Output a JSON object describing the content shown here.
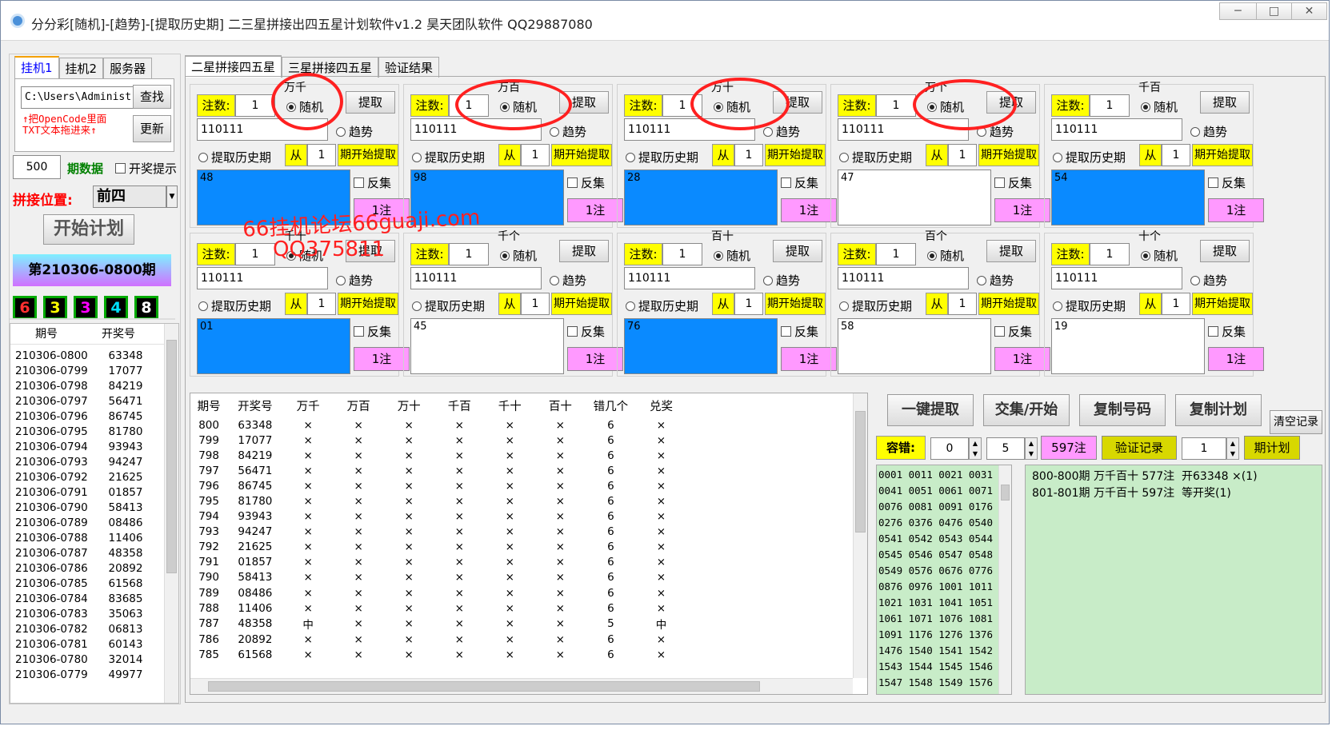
{
  "window": {
    "title": "分分彩[随机]-[趋势]-[提取历史期] 二三星拼接出四五星计划软件v1.2 昊天团队软件 QQ29887080",
    "buttons": {
      "minimize": "─",
      "maximize": "□",
      "close": "✕"
    }
  },
  "left": {
    "tabs": [
      "挂机1",
      "挂机2",
      "服务器"
    ],
    "path": "C:\\Users\\Administ",
    "lookup_btn": "查找",
    "update_btn": "更新",
    "hint_line1": "↑把OpenCode里面",
    "hint_line2": "TXT文本拖进来↑",
    "periods_value": "500",
    "periods_label": "期数据",
    "open_hint": "开奖提示",
    "join_label": "拼接位置:",
    "join_value": "前四",
    "start_btn": "开始计划",
    "current_issue": "第210306-0800期",
    "digits": [
      {
        "v": "6",
        "c": "#ff3030"
      },
      {
        "v": "3",
        "c": "#ffff00"
      },
      {
        "v": "3",
        "c": "#ff00ff"
      },
      {
        "v": "4",
        "c": "#00e0ff"
      },
      {
        "v": "8",
        "c": "#ffffff"
      }
    ],
    "history_headers": [
      "期号",
      "开奖号"
    ],
    "history": [
      [
        "210306-0800",
        "63348"
      ],
      [
        "210306-0799",
        "17077"
      ],
      [
        "210306-0798",
        "84219"
      ],
      [
        "210306-0797",
        "56471"
      ],
      [
        "210306-0796",
        "86745"
      ],
      [
        "210306-0795",
        "81780"
      ],
      [
        "210306-0794",
        "93943"
      ],
      [
        "210306-0793",
        "94247"
      ],
      [
        "210306-0792",
        "21625"
      ],
      [
        "210306-0791",
        "01857"
      ],
      [
        "210306-0790",
        "58413"
      ],
      [
        "210306-0789",
        "08486"
      ],
      [
        "210306-0788",
        "11406"
      ],
      [
        "210306-0787",
        "48358"
      ],
      [
        "210306-0786",
        "20892"
      ],
      [
        "210306-0785",
        "61568"
      ],
      [
        "210306-0784",
        "83685"
      ],
      [
        "210306-0783",
        "35063"
      ],
      [
        "210306-0782",
        "06813"
      ],
      [
        "210306-0781",
        "60143"
      ],
      [
        "210306-0780",
        "32014"
      ],
      [
        "210306-0779",
        "49977"
      ]
    ]
  },
  "main": {
    "tabs": [
      "二星拼接四五星",
      "三星拼接四五星",
      "验证结果"
    ],
    "labels": {
      "zhushu": "注数:",
      "extract": "提取",
      "random": "随机",
      "trend": "趋势",
      "history": "提取历史期",
      "from": "从",
      "period_start": "期开始提取",
      "reverse": "反集",
      "one_bet": "1注"
    },
    "panels": [
      {
        "title": "万千",
        "zhu": "1",
        "code": "110111",
        "from": "1",
        "result": "48",
        "blue": true
      },
      {
        "title": "万百",
        "zhu": "1",
        "code": "110111",
        "from": "1",
        "result": "98",
        "blue": true
      },
      {
        "title": "万十",
        "zhu": "1",
        "code": "110111",
        "from": "1",
        "result": "28",
        "blue": true
      },
      {
        "title": "万个",
        "zhu": "1",
        "code": "110111",
        "from": "1",
        "result": "47",
        "blue": false
      },
      {
        "title": "千百",
        "zhu": "1",
        "code": "110111",
        "from": "1",
        "result": "54",
        "blue": true
      },
      {
        "title": "千十",
        "zhu": "1",
        "code": "110111",
        "from": "1",
        "result": "01",
        "blue": true
      },
      {
        "title": "千个",
        "zhu": "1",
        "code": "110111",
        "from": "1",
        "result": "45",
        "blue": false
      },
      {
        "title": "百十",
        "zhu": "1",
        "code": "110111",
        "from": "1",
        "result": "76",
        "blue": true
      },
      {
        "title": "百个",
        "zhu": "1",
        "code": "110111",
        "from": "1",
        "result": "58",
        "blue": false
      },
      {
        "title": "十个",
        "zhu": "1",
        "code": "110111",
        "from": "1",
        "result": "19",
        "blue": false
      }
    ],
    "grid_headers": [
      "期号",
      "开奖号",
      "万千",
      "万百",
      "万十",
      "千百",
      "千十",
      "百十",
      "错几个",
      "兑奖"
    ],
    "grid_rows": [
      [
        "800",
        "63348",
        "×",
        "×",
        "×",
        "×",
        "×",
        "×",
        "6",
        "×"
      ],
      [
        "799",
        "17077",
        "×",
        "×",
        "×",
        "×",
        "×",
        "×",
        "6",
        "×"
      ],
      [
        "798",
        "84219",
        "×",
        "×",
        "×",
        "×",
        "×",
        "×",
        "6",
        "×"
      ],
      [
        "797",
        "56471",
        "×",
        "×",
        "×",
        "×",
        "×",
        "×",
        "6",
        "×"
      ],
      [
        "796",
        "86745",
        "×",
        "×",
        "×",
        "×",
        "×",
        "×",
        "6",
        "×"
      ],
      [
        "795",
        "81780",
        "×",
        "×",
        "×",
        "×",
        "×",
        "×",
        "6",
        "×"
      ],
      [
        "794",
        "93943",
        "×",
        "×",
        "×",
        "×",
        "×",
        "×",
        "6",
        "×"
      ],
      [
        "793",
        "94247",
        "×",
        "×",
        "×",
        "×",
        "×",
        "×",
        "6",
        "×"
      ],
      [
        "792",
        "21625",
        "×",
        "×",
        "×",
        "×",
        "×",
        "×",
        "6",
        "×"
      ],
      [
        "791",
        "01857",
        "×",
        "×",
        "×",
        "×",
        "×",
        "×",
        "6",
        "×"
      ],
      [
        "790",
        "58413",
        "×",
        "×",
        "×",
        "×",
        "×",
        "×",
        "6",
        "×"
      ],
      [
        "789",
        "08486",
        "×",
        "×",
        "×",
        "×",
        "×",
        "×",
        "6",
        "×"
      ],
      [
        "788",
        "11406",
        "×",
        "×",
        "×",
        "×",
        "×",
        "×",
        "6",
        "×"
      ],
      [
        "787",
        "48358",
        "中",
        "×",
        "×",
        "×",
        "×",
        "×",
        "5",
        "中"
      ],
      [
        "786",
        "20892",
        "×",
        "×",
        "×",
        "×",
        "×",
        "×",
        "6",
        "×"
      ],
      [
        "785",
        "61568",
        "×",
        "×",
        "×",
        "×",
        "×",
        "×",
        "6",
        "×"
      ]
    ],
    "actions": [
      "一键提取",
      "交集/开始",
      "复制号码",
      "复制计划"
    ],
    "clear_btn": "清空记录",
    "tolerance_label": "容错:",
    "tol_min": "0",
    "tol_max": "5",
    "count_btn": "597注",
    "verify_btn": "验证记录",
    "plan_periods": "1",
    "plan_label": "期计划",
    "codes": [
      "0001 0011 0021 0031",
      "0041 0051 0061 0071",
      "0076 0081 0091 0176",
      "0276 0376 0476 0540",
      "0541 0542 0543 0544",
      "0545 0546 0547 0548",
      "0549 0576 0676 0776",
      "0876 0976 1001 1011",
      "1021 1031 1041 1051",
      "1061 1071 1076 1081",
      "1091 1176 1276 1376",
      "1476 1540 1541 1542",
      "1543 1544 1545 1546",
      "1547 1548 1549 1576"
    ],
    "plan_log": [
      "800-800期 万千百十 577注  开63348 ×(1)",
      "801-801期 万千百十 597注  等开奖(1)"
    ]
  },
  "watermark": {
    "line1": "66挂机论坛66guaji.com",
    "line2": "QQ375811"
  }
}
